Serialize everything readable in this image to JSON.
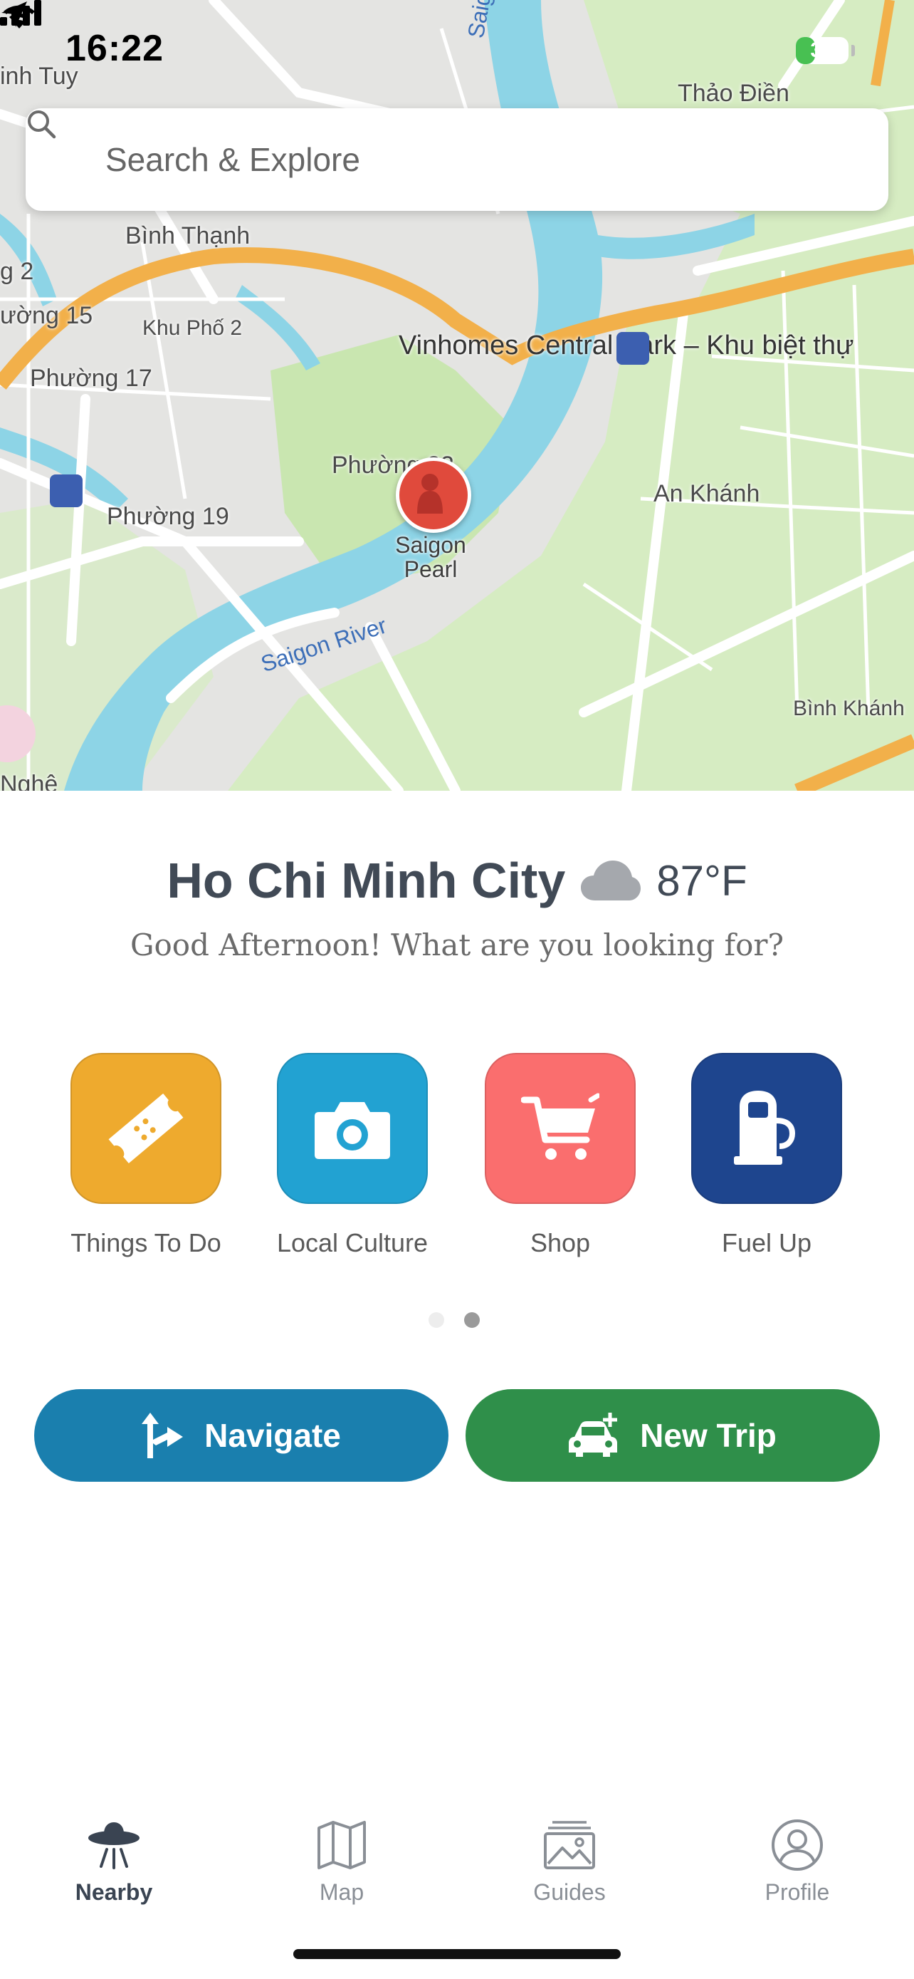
{
  "status_bar": {
    "time": "16:22",
    "battery": "37"
  },
  "search": {
    "placeholder": "Search & Explore"
  },
  "map": {
    "labels": {
      "thao_dien": "Thảo Điền",
      "binh_thanh": "Bình Thạnh",
      "phuong_15": "ường 15",
      "khu_pho_2": "Khu Phố 2",
      "phuong_17": "Phường 17",
      "phuong_19": "Phường 19",
      "phuong_22": "Phường 22",
      "an_khanh": "An Khánh",
      "binh_khanh": "Bình Khánh",
      "saigon_river": "Saigon River",
      "saigon_river_top": "Saigon R",
      "vinhomes": "Vinhomes Central Park – Khu biệt thự",
      "nghe": "Nghệ",
      "inh_tuy": "inh Tuy",
      "ng_2": "g 2"
    },
    "pin_label": "Saigon Pearl"
  },
  "header": {
    "city": "Ho Chi Minh City",
    "temperature": "87°F",
    "weather_icon": "cloud-icon",
    "greeting": "Good Afternoon! What are you looking for?"
  },
  "categories": [
    {
      "label": "Things To Do",
      "icon": "ticket-icon",
      "color": "#eeaa2e"
    },
    {
      "label": "Local Culture",
      "icon": "camera-icon",
      "color": "#22a2d2"
    },
    {
      "label": "Shop",
      "icon": "cart-icon",
      "color": "#fa6e6e"
    },
    {
      "label": "Fuel Up",
      "icon": "fuel-pump-icon",
      "color": "#1e458e"
    }
  ],
  "pager": {
    "pages": 2,
    "active": 2
  },
  "actions": {
    "navigate": {
      "label": "Navigate",
      "color": "#1a7fae"
    },
    "new_trip": {
      "label": "New Trip",
      "color": "#2f8f4a"
    }
  },
  "tabs": [
    {
      "label": "Nearby",
      "icon": "ufo-icon",
      "active": true
    },
    {
      "label": "Map",
      "icon": "map-icon",
      "active": false
    },
    {
      "label": "Guides",
      "icon": "guides-icon",
      "active": false
    },
    {
      "label": "Profile",
      "icon": "profile-icon",
      "active": false
    }
  ],
  "colors": {
    "tab_active": "#3a4452",
    "tab_inactive": "#8a8f96"
  }
}
